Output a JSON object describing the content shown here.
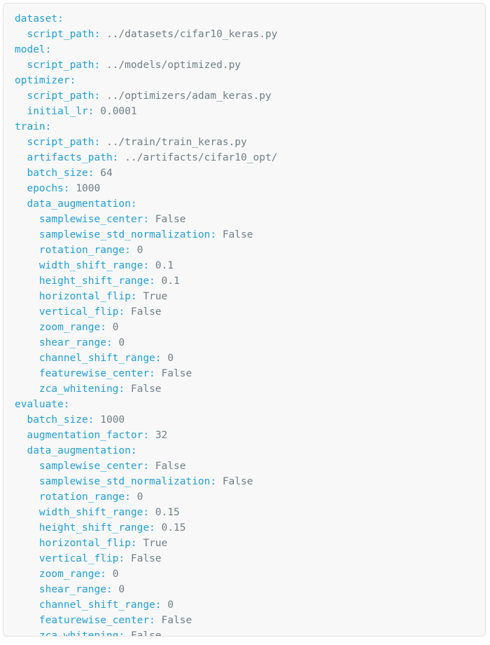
{
  "document": {
    "type": "yaml-config",
    "colors": {
      "key": "#1f9fd4",
      "value": "#6f7f87",
      "background": "#f8f8f8",
      "border": "#e2e2e2",
      "page": "#ffffff"
    }
  },
  "lines": [
    {
      "indent": 0,
      "key": "dataset:",
      "value": ""
    },
    {
      "indent": 1,
      "key": "script_path:",
      "value": "../datasets/cifar10_keras.py"
    },
    {
      "indent": 0,
      "key": "model:",
      "value": ""
    },
    {
      "indent": 1,
      "key": "script_path:",
      "value": "../models/optimized.py"
    },
    {
      "indent": 0,
      "key": "optimizer:",
      "value": ""
    },
    {
      "indent": 1,
      "key": "script_path:",
      "value": "../optimizers/adam_keras.py"
    },
    {
      "indent": 1,
      "key": "initial_lr:",
      "value": "0.0001"
    },
    {
      "indent": 0,
      "key": "train:",
      "value": ""
    },
    {
      "indent": 1,
      "key": "script_path:",
      "value": "../train/train_keras.py"
    },
    {
      "indent": 1,
      "key": "artifacts_path:",
      "value": "../artifacts/cifar10_opt/"
    },
    {
      "indent": 1,
      "key": "batch_size:",
      "value": "64"
    },
    {
      "indent": 1,
      "key": "epochs:",
      "value": "1000"
    },
    {
      "indent": 1,
      "key": "data_augmentation:",
      "value": ""
    },
    {
      "indent": 2,
      "key": "samplewise_center:",
      "value": "False"
    },
    {
      "indent": 2,
      "key": "samplewise_std_normalization:",
      "value": "False"
    },
    {
      "indent": 2,
      "key": "rotation_range:",
      "value": "0"
    },
    {
      "indent": 2,
      "key": "width_shift_range:",
      "value": "0.1"
    },
    {
      "indent": 2,
      "key": "height_shift_range:",
      "value": "0.1"
    },
    {
      "indent": 2,
      "key": "horizontal_flip:",
      "value": "True"
    },
    {
      "indent": 2,
      "key": "vertical_flip:",
      "value": "False"
    },
    {
      "indent": 2,
      "key": "zoom_range:",
      "value": "0"
    },
    {
      "indent": 2,
      "key": "shear_range:",
      "value": "0"
    },
    {
      "indent": 2,
      "key": "channel_shift_range:",
      "value": "0"
    },
    {
      "indent": 2,
      "key": "featurewise_center:",
      "value": "False"
    },
    {
      "indent": 2,
      "key": "zca_whitening:",
      "value": "False"
    },
    {
      "indent": 0,
      "key": "evaluate:",
      "value": ""
    },
    {
      "indent": 1,
      "key": "batch_size:",
      "value": "1000"
    },
    {
      "indent": 1,
      "key": "augmentation_factor:",
      "value": "32"
    },
    {
      "indent": 1,
      "key": "data_augmentation:",
      "value": ""
    },
    {
      "indent": 2,
      "key": "samplewise_center:",
      "value": "False"
    },
    {
      "indent": 2,
      "key": "samplewise_std_normalization:",
      "value": "False"
    },
    {
      "indent": 2,
      "key": "rotation_range:",
      "value": "0"
    },
    {
      "indent": 2,
      "key": "width_shift_range:",
      "value": "0.15"
    },
    {
      "indent": 2,
      "key": "height_shift_range:",
      "value": "0.15"
    },
    {
      "indent": 2,
      "key": "horizontal_flip:",
      "value": "True"
    },
    {
      "indent": 2,
      "key": "vertical_flip:",
      "value": "False"
    },
    {
      "indent": 2,
      "key": "zoom_range:",
      "value": "0"
    },
    {
      "indent": 2,
      "key": "shear_range:",
      "value": "0"
    },
    {
      "indent": 2,
      "key": "channel_shift_range:",
      "value": "0"
    },
    {
      "indent": 2,
      "key": "featurewise_center:",
      "value": "False"
    },
    {
      "indent": 2,
      "key": "zca_whitening:",
      "value": "False"
    }
  ]
}
